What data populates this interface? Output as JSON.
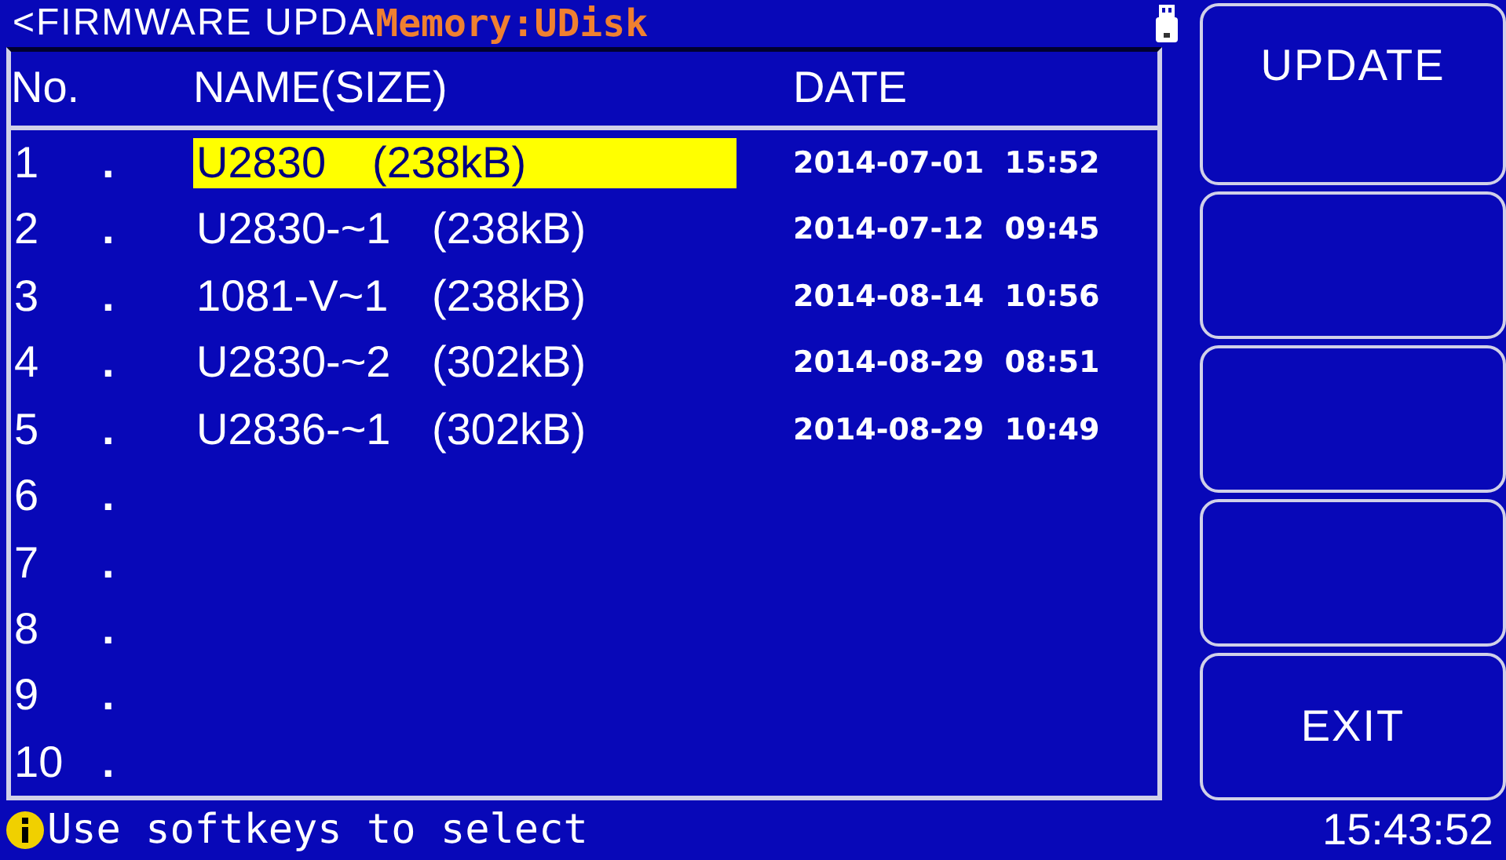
{
  "header": {
    "title": "<FIRMWARE UPDA",
    "memory": "Memory:UDisk"
  },
  "table": {
    "columns": [
      "No.",
      "NAME(SIZE)",
      "DATE"
    ],
    "rows": [
      {
        "no": "1",
        "separator": ".",
        "name": "U2830",
        "size": "(238kB)",
        "date": "2014-07-01  15:52",
        "selected": true
      },
      {
        "no": "2",
        "separator": ".",
        "name": "U2830-~1",
        "size": "(238kB)",
        "date": "2014-07-12  09:45",
        "selected": false
      },
      {
        "no": "3",
        "separator": ".",
        "name": "1081-V~1",
        "size": "(238kB)",
        "date": "2014-08-14  10:56",
        "selected": false
      },
      {
        "no": "4",
        "separator": ".",
        "name": "U2830-~2",
        "size": "(302kB)",
        "date": "2014-08-29  08:51",
        "selected": false
      },
      {
        "no": "5",
        "separator": ".",
        "name": "U2836-~1",
        "size": "(302kB)",
        "date": "2014-08-29  10:49",
        "selected": false
      },
      {
        "no": "6",
        "separator": "."
      },
      {
        "no": "7",
        "separator": "."
      },
      {
        "no": "8",
        "separator": "."
      },
      {
        "no": "9",
        "separator": "."
      },
      {
        "no": "10",
        "separator": "."
      }
    ]
  },
  "softkeys": {
    "top": "UPDATE",
    "bottom": "EXIT"
  },
  "status": {
    "message": "Use softkeys to select",
    "time": "15:43:52"
  }
}
